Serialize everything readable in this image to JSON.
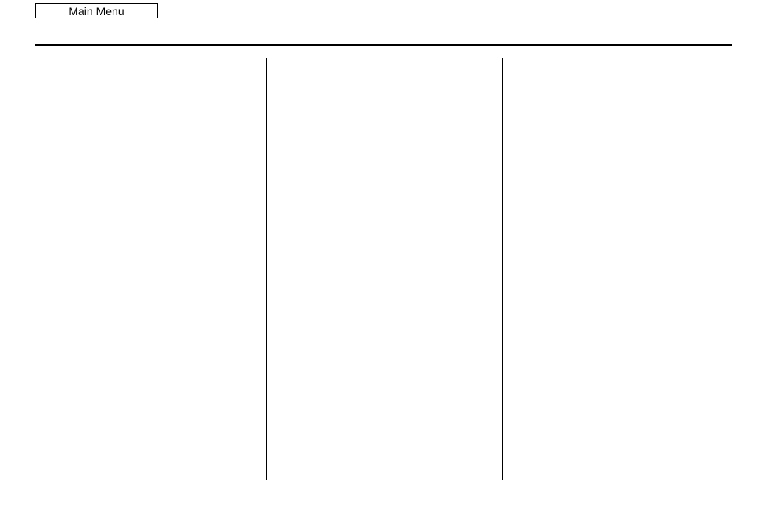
{
  "header": {
    "main_menu_label": "Main Menu"
  }
}
